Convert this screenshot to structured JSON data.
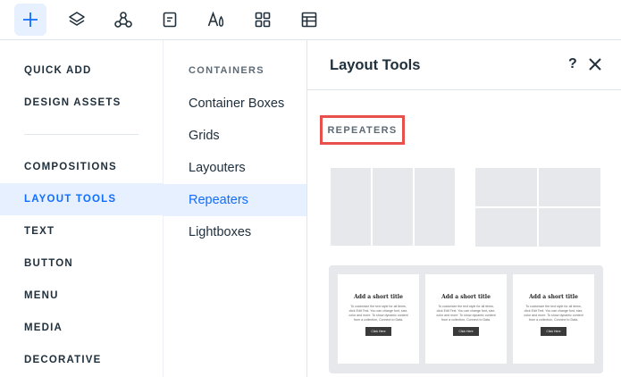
{
  "toolbar": {
    "icons": [
      "add-icon",
      "layers-icon",
      "connections-icon",
      "page-icon",
      "text-theme-icon",
      "apps-grid-icon",
      "table-icon"
    ],
    "accent": "#116dff"
  },
  "categories": {
    "items": [
      {
        "label": "QUICK ADD"
      },
      {
        "label": "DESIGN ASSETS"
      },
      {
        "label": "COMPOSITIONS"
      },
      {
        "label": "LAYOUT TOOLS"
      },
      {
        "label": "TEXT"
      },
      {
        "label": "BUTTON"
      },
      {
        "label": "MENU"
      },
      {
        "label": "MEDIA"
      },
      {
        "label": "DECORATIVE"
      }
    ],
    "selected": "LAYOUT TOOLS"
  },
  "subcategories": {
    "header": "CONTAINERS",
    "items": [
      {
        "label": "Container Boxes"
      },
      {
        "label": "Grids"
      },
      {
        "label": "Layouters"
      },
      {
        "label": "Repeaters"
      },
      {
        "label": "Lightboxes"
      }
    ],
    "selected": "Repeaters"
  },
  "panel": {
    "title": "Layout Tools",
    "help": "?",
    "section_label": "REPEATERS",
    "highlight_color": "#e8504b",
    "card": {
      "title": "Add a short title",
      "body": "To customize the text style for all items, click Edit Text. You can change font, size, color and more. To show dynamic content from a collection, Connect to Data.",
      "button": "Click Here"
    }
  }
}
